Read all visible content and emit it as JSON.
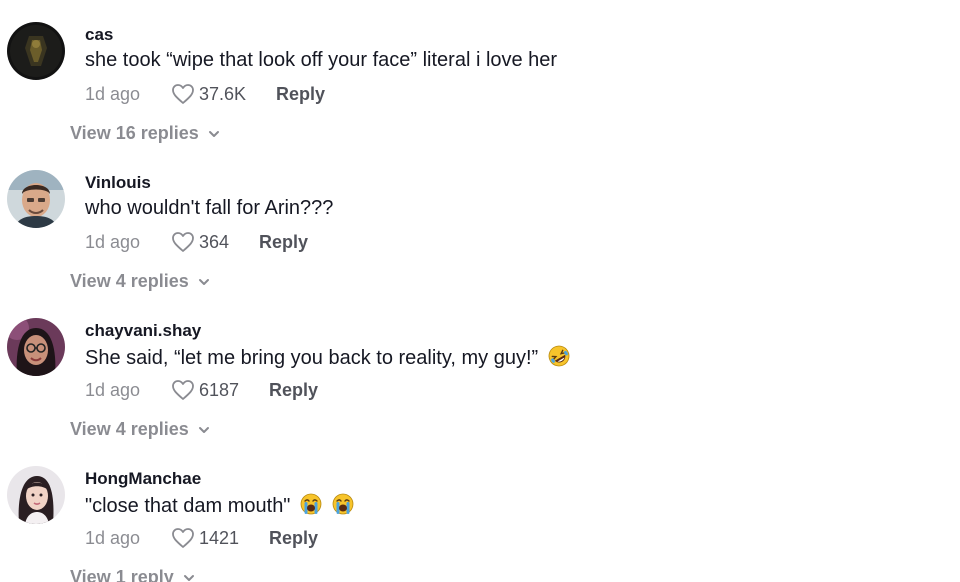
{
  "comments": [
    {
      "username": "cas",
      "text": "she took “wipe that look off your face” literal i love her",
      "time": "1d ago",
      "likes": "37.6K",
      "reply_label": "Reply",
      "view_replies": "View 16 replies",
      "avatar": "dark-figure-avatar",
      "emojis": []
    },
    {
      "username": "Vinlouis",
      "text": "who wouldn't fall for Arin???",
      "time": "1d ago",
      "likes": "364",
      "reply_label": "Reply",
      "view_replies": "View 4 replies",
      "avatar": "man-photo-avatar",
      "emojis": []
    },
    {
      "username": "chayvani.shay",
      "text": "She said, “let me bring you back to reality, my guy!”",
      "time": "1d ago",
      "likes": "6187",
      "reply_label": "Reply",
      "view_replies": "View 4 replies",
      "avatar": "woman-glasses-avatar",
      "emojis": [
        "rolling-on-floor-laughing"
      ]
    },
    {
      "username": "HongManchae",
      "text": "\"close that dam mouth\"",
      "time": "1d ago",
      "likes": "1421",
      "reply_label": "Reply",
      "view_replies": "View 1 reply",
      "avatar": "woman-portrait-avatar",
      "emojis": [
        "loudly-crying-face",
        "loudly-crying-face"
      ]
    }
  ],
  "colors": {
    "text_primary": "#161823",
    "text_secondary": "#8a8b91",
    "emoji_yellow": "#f7c42b",
    "emoji_tear": "#4aa3e0"
  },
  "icons": {
    "like": "heart-outline-icon",
    "expand": "chevron-down-icon"
  }
}
